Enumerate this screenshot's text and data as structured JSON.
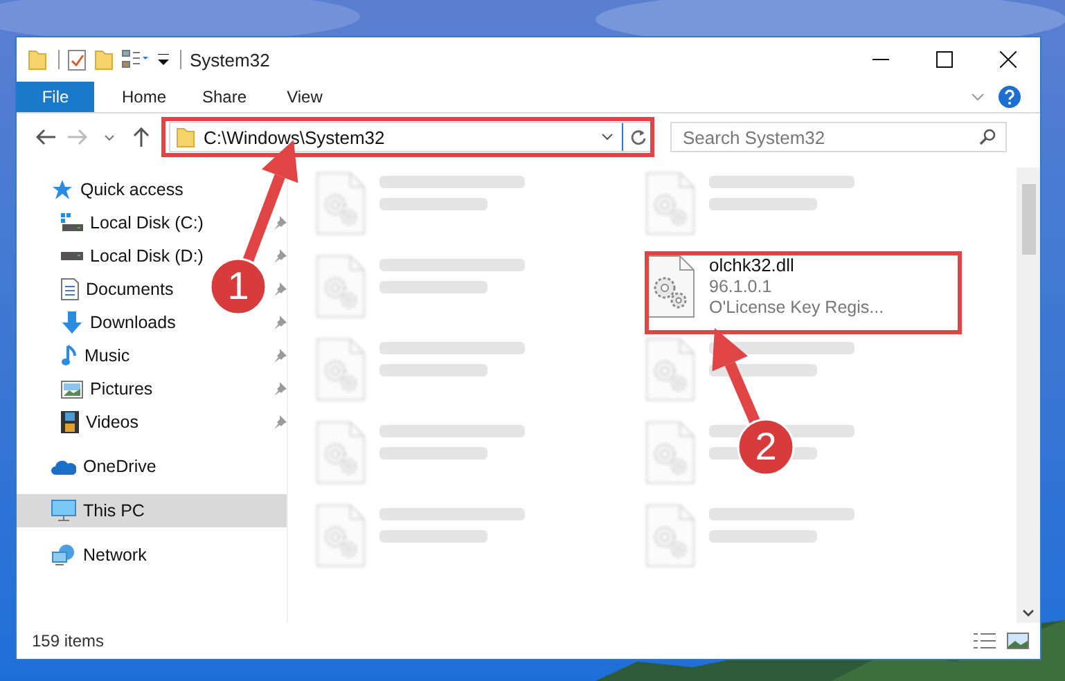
{
  "window": {
    "title": "System32"
  },
  "ribbon": {
    "file_button": "File",
    "tabs": [
      "Home",
      "Share",
      "View"
    ]
  },
  "address_bar": {
    "path": "C:\\Windows\\System32"
  },
  "search": {
    "placeholder": "Search System32"
  },
  "nav": [
    {
      "label": "Quick access",
      "kind": "star",
      "selected": false,
      "children": [
        {
          "label": "Local Disk (C:)",
          "kind": "system-drive",
          "pinned": true,
          "selected": false
        },
        {
          "label": "Local Disk (D:)",
          "kind": "drive",
          "pinned": true,
          "selected": false
        },
        {
          "label": "Documents",
          "kind": "documents",
          "pinned": true,
          "selected": false
        },
        {
          "label": "Downloads",
          "kind": "downloads",
          "pinned": true,
          "selected": false
        },
        {
          "label": "Music",
          "kind": "music",
          "pinned": true,
          "selected": false
        },
        {
          "label": "Pictures",
          "kind": "pictures",
          "pinned": true,
          "selected": false
        },
        {
          "label": "Videos",
          "kind": "videos",
          "pinned": true,
          "selected": false
        }
      ]
    },
    {
      "label": "OneDrive",
      "kind": "cloud",
      "selected": false
    },
    {
      "label": "This PC",
      "kind": "pc",
      "selected": true
    },
    {
      "label": "Network",
      "kind": "network",
      "selected": false
    }
  ],
  "files": [
    {
      "kind": "obscured"
    },
    {
      "kind": "obscured"
    },
    {
      "kind": "obscured"
    },
    {
      "kind": "file",
      "name": "olchk32.dll",
      "lines": [
        "96.1.0.1",
        "O'License Key Regis..."
      ]
    },
    {
      "kind": "obscured"
    },
    {
      "kind": "obscured"
    },
    {
      "kind": "obscured"
    },
    {
      "kind": "obscured"
    },
    {
      "kind": "obscured"
    },
    {
      "kind": "obscured"
    }
  ],
  "status_bar": {
    "count": "159 items"
  },
  "annotations": [
    {
      "number": "1"
    },
    {
      "number": "2"
    }
  ]
}
